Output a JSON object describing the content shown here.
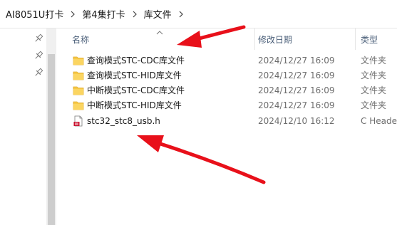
{
  "breadcrumb": {
    "items": [
      "AI8051U打卡",
      "第4集打卡",
      "库文件"
    ]
  },
  "columns": {
    "name": "名称",
    "date": "修改日期",
    "type": "类型"
  },
  "files": [
    {
      "name": "查询模式STC-CDC库文件",
      "date": "2024/12/27 16:09",
      "type": "文件夹",
      "icon": "folder-icon"
    },
    {
      "name": "查询模式STC-HID库文件",
      "date": "2024/12/27 16:09",
      "type": "文件夹",
      "icon": "folder-icon"
    },
    {
      "name": "中断模式STC-CDC库文件",
      "date": "2024/12/27 16:09",
      "type": "文件夹",
      "icon": "folder-icon"
    },
    {
      "name": "中断模式STC-HID库文件",
      "date": "2024/12/27 16:09",
      "type": "文件夹",
      "icon": "folder-icon"
    },
    {
      "name": "stc32_stc8_usb.h",
      "date": "2024/12/10 16:12",
      "type": "C Heade",
      "icon": "c-header-file-icon"
    }
  ],
  "colors": {
    "folder": "#f7c948",
    "folder_dark": "#e0a922",
    "annotation_arrow": "#e8101a",
    "header_text": "#4c607a"
  }
}
